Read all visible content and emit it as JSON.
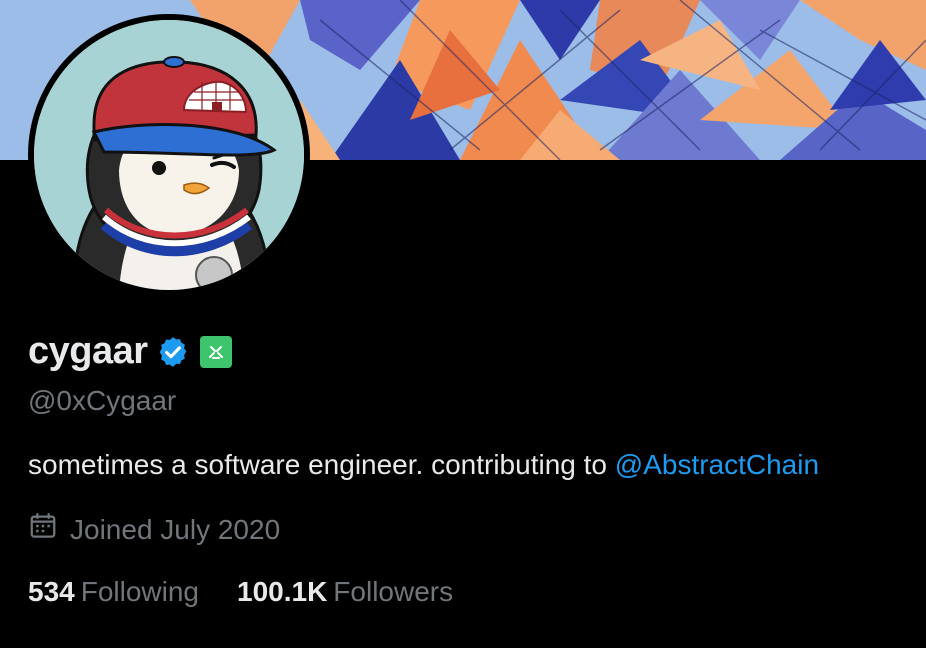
{
  "profile": {
    "display_name": "cygaar",
    "handle": "@0xCygaar",
    "bio_text": "sometimes a software engineer. contributing to ",
    "bio_mention": "@AbstractChain",
    "joined": "Joined July 2020",
    "following_count": "534",
    "following_label": "Following",
    "followers_count": "100.1K",
    "followers_label": "Followers"
  },
  "icons": {
    "verified": "verified-badge-icon",
    "affiliate": "affiliate-badge-icon",
    "calendar": "calendar-icon"
  },
  "colors": {
    "background": "#000000",
    "primary_text": "#e7e9ea",
    "secondary_text": "#71767b",
    "link": "#1d9bf0",
    "verified": "#1d9bf0",
    "affiliate": "#3ec46d"
  }
}
